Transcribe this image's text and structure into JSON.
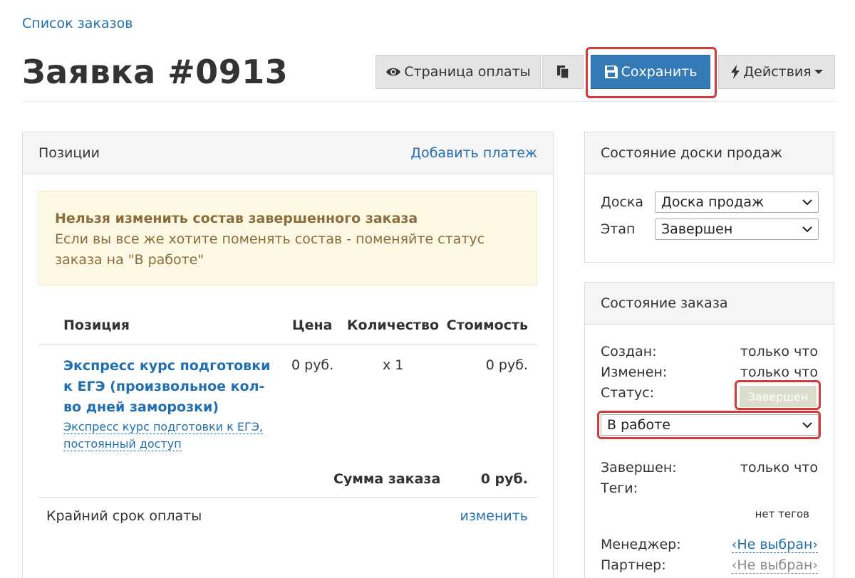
{
  "breadcrumb": {
    "label": "Список заказов"
  },
  "title": "Заявка #0913",
  "toolbar": {
    "payment_page": "Страница оплаты",
    "save": "Сохранить",
    "actions": "Действия"
  },
  "positions_panel": {
    "header": "Позиции",
    "add_payment": "Добавить платеж",
    "alert": {
      "title": "Нельзя изменить состав завершенного заказа",
      "text": "Если вы все же хотите поменять состав - поменяйте статус заказа на \"В работе\""
    },
    "columns": [
      "Позиция",
      "Цена",
      "Количество",
      "Стоимость"
    ],
    "rows": [
      {
        "title": "Экспресс курс подготовки к ЕГЭ (произвольное кол-во дней заморозки)",
        "subtitle": "Экспресс курс подготовки к ЕГЭ, постоянный доступ",
        "price": "0 руб.",
        "quantity": "x 1",
        "cost": "0 руб."
      }
    ],
    "total_label": "Сумма заказа",
    "total_value": "0 руб.",
    "due_label": "Крайний срок оплаты",
    "due_link": "изменить"
  },
  "board_panel": {
    "header": "Состояние доски продаж",
    "board_label": "Доска",
    "board_value": "Доска продаж",
    "stage_label": "Этап",
    "stage_value": "Завершен"
  },
  "order_panel": {
    "header": "Состояние заказа",
    "created_label": "Создан:",
    "created_value": "только что",
    "modified_label": "Изменен:",
    "modified_value": "только что",
    "status_label": "Статус:",
    "status_badge": "Завершен",
    "status_select": "В работе",
    "finished_label": "Завершен:",
    "finished_value": "только что",
    "tags_label": "Теги:",
    "tags_value": "нет тегов",
    "manager_label": "Менеджер:",
    "manager_value": "‹Не выбран›",
    "partner_label": "Партнер:",
    "partner_value": "‹Не выбран›"
  },
  "colors": {
    "accent": "#337ab7",
    "link": "#1f6fb2",
    "highlight": "#d33a3a",
    "alert_bg": "#fcf8e3"
  }
}
